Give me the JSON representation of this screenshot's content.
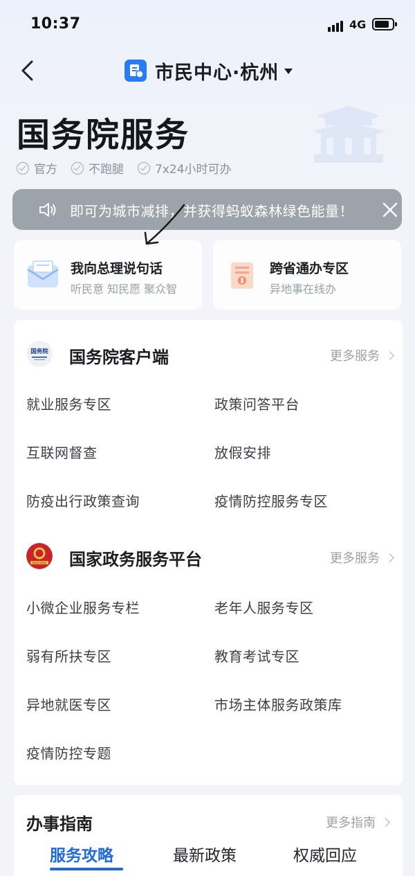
{
  "status_bar": {
    "time": "10:37",
    "network": "4G"
  },
  "nav": {
    "title": "市民中心·杭州"
  },
  "header": {
    "title": "国务院服务",
    "tags": [
      "官方",
      "不跑腿",
      "7x24小时可办"
    ]
  },
  "toast": {
    "text": "即可为城市减排，并获得蚂蚁森林绿色能量！"
  },
  "quick_cards": [
    {
      "title": "我向总理说句话",
      "subtitle": "听民意 知民愿 聚众智"
    },
    {
      "title": "跨省通办专区",
      "subtitle": "异地事在线办"
    }
  ],
  "sections": [
    {
      "title": "国务院客户端",
      "logo_text": "国务院",
      "more": "更多服务",
      "items": [
        "就业服务专区",
        "政策问答平台",
        "互联网督查",
        "放假安排",
        "防疫出行政策查询",
        "疫情防控服务专区"
      ]
    },
    {
      "title": "国家政务服务平台",
      "logo_text": "国家政务服务",
      "more": "更多服务",
      "items": [
        "小微企业服务专栏",
        "老年人服务专区",
        "弱有所扶专区",
        "教育考试专区",
        "异地就医专区",
        "市场主体服务政策库",
        "疫情防控专题"
      ]
    }
  ],
  "guide": {
    "title": "办事指南",
    "more": "更多指南",
    "tabs": [
      "服务攻略",
      "最新政策",
      "权威回应"
    ],
    "active_tab": "服务攻略"
  },
  "colors": {
    "accent": "#1f6ad8",
    "app_logo": "#2a7bf5",
    "toast_bg": "#969ba4"
  }
}
